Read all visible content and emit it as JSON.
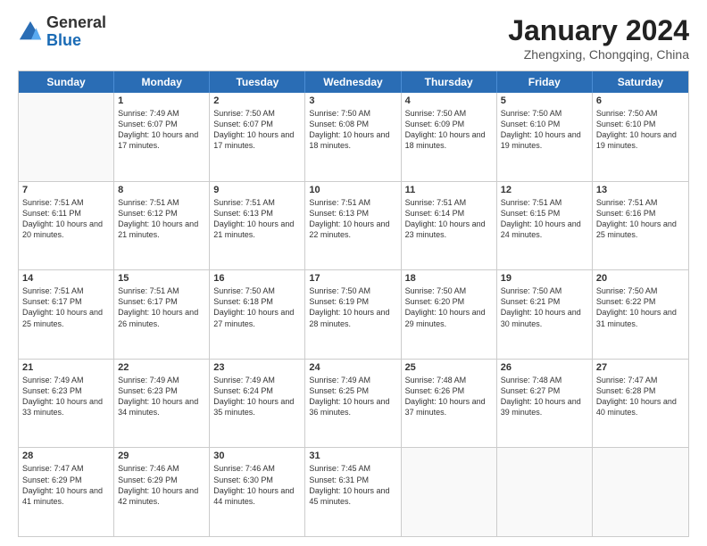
{
  "logo": {
    "general": "General",
    "blue": "Blue"
  },
  "title": "January 2024",
  "subtitle": "Zhengxing, Chongqing, China",
  "header_days": [
    "Sunday",
    "Monday",
    "Tuesday",
    "Wednesday",
    "Thursday",
    "Friday",
    "Saturday"
  ],
  "weeks": [
    [
      {
        "day": "",
        "sunrise": "",
        "sunset": "",
        "daylight": "",
        "empty": true
      },
      {
        "day": "1",
        "sunrise": "Sunrise: 7:49 AM",
        "sunset": "Sunset: 6:07 PM",
        "daylight": "Daylight: 10 hours and 17 minutes."
      },
      {
        "day": "2",
        "sunrise": "Sunrise: 7:50 AM",
        "sunset": "Sunset: 6:07 PM",
        "daylight": "Daylight: 10 hours and 17 minutes."
      },
      {
        "day": "3",
        "sunrise": "Sunrise: 7:50 AM",
        "sunset": "Sunset: 6:08 PM",
        "daylight": "Daylight: 10 hours and 18 minutes."
      },
      {
        "day": "4",
        "sunrise": "Sunrise: 7:50 AM",
        "sunset": "Sunset: 6:09 PM",
        "daylight": "Daylight: 10 hours and 18 minutes."
      },
      {
        "day": "5",
        "sunrise": "Sunrise: 7:50 AM",
        "sunset": "Sunset: 6:10 PM",
        "daylight": "Daylight: 10 hours and 19 minutes."
      },
      {
        "day": "6",
        "sunrise": "Sunrise: 7:50 AM",
        "sunset": "Sunset: 6:10 PM",
        "daylight": "Daylight: 10 hours and 19 minutes."
      }
    ],
    [
      {
        "day": "7",
        "sunrise": "Sunrise: 7:51 AM",
        "sunset": "Sunset: 6:11 PM",
        "daylight": "Daylight: 10 hours and 20 minutes."
      },
      {
        "day": "8",
        "sunrise": "Sunrise: 7:51 AM",
        "sunset": "Sunset: 6:12 PM",
        "daylight": "Daylight: 10 hours and 21 minutes."
      },
      {
        "day": "9",
        "sunrise": "Sunrise: 7:51 AM",
        "sunset": "Sunset: 6:13 PM",
        "daylight": "Daylight: 10 hours and 21 minutes."
      },
      {
        "day": "10",
        "sunrise": "Sunrise: 7:51 AM",
        "sunset": "Sunset: 6:13 PM",
        "daylight": "Daylight: 10 hours and 22 minutes."
      },
      {
        "day": "11",
        "sunrise": "Sunrise: 7:51 AM",
        "sunset": "Sunset: 6:14 PM",
        "daylight": "Daylight: 10 hours and 23 minutes."
      },
      {
        "day": "12",
        "sunrise": "Sunrise: 7:51 AM",
        "sunset": "Sunset: 6:15 PM",
        "daylight": "Daylight: 10 hours and 24 minutes."
      },
      {
        "day": "13",
        "sunrise": "Sunrise: 7:51 AM",
        "sunset": "Sunset: 6:16 PM",
        "daylight": "Daylight: 10 hours and 25 minutes."
      }
    ],
    [
      {
        "day": "14",
        "sunrise": "Sunrise: 7:51 AM",
        "sunset": "Sunset: 6:17 PM",
        "daylight": "Daylight: 10 hours and 25 minutes."
      },
      {
        "day": "15",
        "sunrise": "Sunrise: 7:51 AM",
        "sunset": "Sunset: 6:17 PM",
        "daylight": "Daylight: 10 hours and 26 minutes."
      },
      {
        "day": "16",
        "sunrise": "Sunrise: 7:50 AM",
        "sunset": "Sunset: 6:18 PM",
        "daylight": "Daylight: 10 hours and 27 minutes."
      },
      {
        "day": "17",
        "sunrise": "Sunrise: 7:50 AM",
        "sunset": "Sunset: 6:19 PM",
        "daylight": "Daylight: 10 hours and 28 minutes."
      },
      {
        "day": "18",
        "sunrise": "Sunrise: 7:50 AM",
        "sunset": "Sunset: 6:20 PM",
        "daylight": "Daylight: 10 hours and 29 minutes."
      },
      {
        "day": "19",
        "sunrise": "Sunrise: 7:50 AM",
        "sunset": "Sunset: 6:21 PM",
        "daylight": "Daylight: 10 hours and 30 minutes."
      },
      {
        "day": "20",
        "sunrise": "Sunrise: 7:50 AM",
        "sunset": "Sunset: 6:22 PM",
        "daylight": "Daylight: 10 hours and 31 minutes."
      }
    ],
    [
      {
        "day": "21",
        "sunrise": "Sunrise: 7:49 AM",
        "sunset": "Sunset: 6:23 PM",
        "daylight": "Daylight: 10 hours and 33 minutes."
      },
      {
        "day": "22",
        "sunrise": "Sunrise: 7:49 AM",
        "sunset": "Sunset: 6:23 PM",
        "daylight": "Daylight: 10 hours and 34 minutes."
      },
      {
        "day": "23",
        "sunrise": "Sunrise: 7:49 AM",
        "sunset": "Sunset: 6:24 PM",
        "daylight": "Daylight: 10 hours and 35 minutes."
      },
      {
        "day": "24",
        "sunrise": "Sunrise: 7:49 AM",
        "sunset": "Sunset: 6:25 PM",
        "daylight": "Daylight: 10 hours and 36 minutes."
      },
      {
        "day": "25",
        "sunrise": "Sunrise: 7:48 AM",
        "sunset": "Sunset: 6:26 PM",
        "daylight": "Daylight: 10 hours and 37 minutes."
      },
      {
        "day": "26",
        "sunrise": "Sunrise: 7:48 AM",
        "sunset": "Sunset: 6:27 PM",
        "daylight": "Daylight: 10 hours and 39 minutes."
      },
      {
        "day": "27",
        "sunrise": "Sunrise: 7:47 AM",
        "sunset": "Sunset: 6:28 PM",
        "daylight": "Daylight: 10 hours and 40 minutes."
      }
    ],
    [
      {
        "day": "28",
        "sunrise": "Sunrise: 7:47 AM",
        "sunset": "Sunset: 6:29 PM",
        "daylight": "Daylight: 10 hours and 41 minutes."
      },
      {
        "day": "29",
        "sunrise": "Sunrise: 7:46 AM",
        "sunset": "Sunset: 6:29 PM",
        "daylight": "Daylight: 10 hours and 42 minutes."
      },
      {
        "day": "30",
        "sunrise": "Sunrise: 7:46 AM",
        "sunset": "Sunset: 6:30 PM",
        "daylight": "Daylight: 10 hours and 44 minutes."
      },
      {
        "day": "31",
        "sunrise": "Sunrise: 7:45 AM",
        "sunset": "Sunset: 6:31 PM",
        "daylight": "Daylight: 10 hours and 45 minutes."
      },
      {
        "day": "",
        "sunrise": "",
        "sunset": "",
        "daylight": "",
        "empty": true
      },
      {
        "day": "",
        "sunrise": "",
        "sunset": "",
        "daylight": "",
        "empty": true
      },
      {
        "day": "",
        "sunrise": "",
        "sunset": "",
        "daylight": "",
        "empty": true
      }
    ]
  ]
}
